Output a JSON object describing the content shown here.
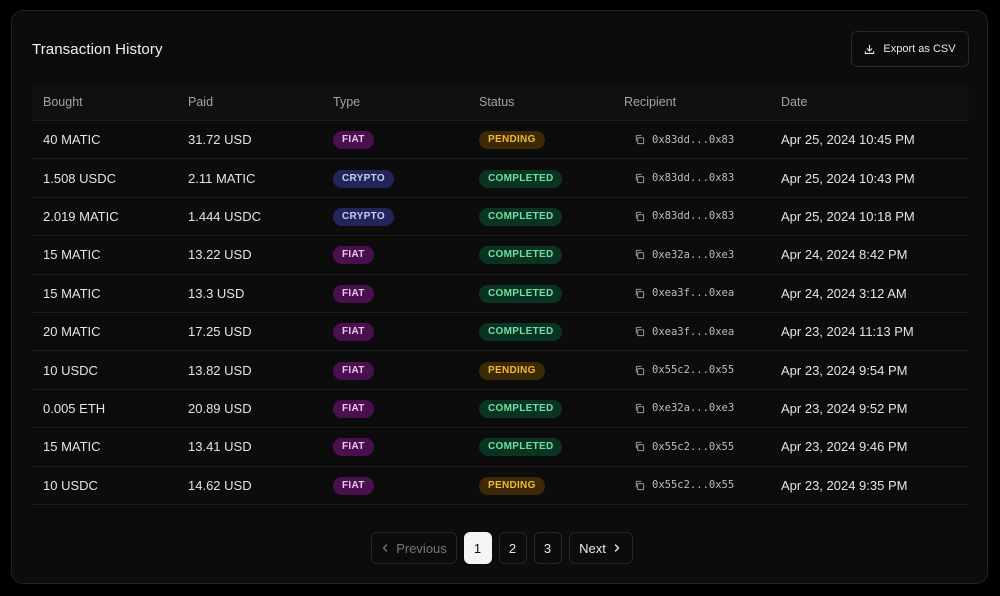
{
  "header": {
    "title": "Transaction History",
    "export_label": "Export as CSV"
  },
  "columns": [
    "Bought",
    "Paid",
    "Type",
    "Status",
    "Recipient",
    "Date"
  ],
  "rows": [
    {
      "bought": "40 MATIC",
      "paid": "31.72 USD",
      "type": "FIAT",
      "status": "PENDING",
      "recipient": "0x83dd...0x83",
      "date": "Apr 25, 2024 10:45 PM"
    },
    {
      "bought": "1.508 USDC",
      "paid": "2.11 MATIC",
      "type": "CRYPTO",
      "status": "COMPLETED",
      "recipient": "0x83dd...0x83",
      "date": "Apr 25, 2024 10:43 PM"
    },
    {
      "bought": "2.019 MATIC",
      "paid": "1.444 USDC",
      "type": "CRYPTO",
      "status": "COMPLETED",
      "recipient": "0x83dd...0x83",
      "date": "Apr 25, 2024 10:18 PM"
    },
    {
      "bought": "15 MATIC",
      "paid": "13.22 USD",
      "type": "FIAT",
      "status": "COMPLETED",
      "recipient": "0xe32a...0xe3",
      "date": "Apr 24, 2024 8:42 PM"
    },
    {
      "bought": "15 MATIC",
      "paid": "13.3 USD",
      "type": "FIAT",
      "status": "COMPLETED",
      "recipient": "0xea3f...0xea",
      "date": "Apr 24, 2024 3:12 AM"
    },
    {
      "bought": "20 MATIC",
      "paid": "17.25 USD",
      "type": "FIAT",
      "status": "COMPLETED",
      "recipient": "0xea3f...0xea",
      "date": "Apr 23, 2024 11:13 PM"
    },
    {
      "bought": "10 USDC",
      "paid": "13.82 USD",
      "type": "FIAT",
      "status": "PENDING",
      "recipient": "0x55c2...0x55",
      "date": "Apr 23, 2024 9:54 PM"
    },
    {
      "bought": "0.005 ETH",
      "paid": "20.89 USD",
      "type": "FIAT",
      "status": "COMPLETED",
      "recipient": "0xe32a...0xe3",
      "date": "Apr 23, 2024 9:52 PM"
    },
    {
      "bought": "15 MATIC",
      "paid": "13.41 USD",
      "type": "FIAT",
      "status": "COMPLETED",
      "recipient": "0x55c2...0x55",
      "date": "Apr 23, 2024 9:46 PM"
    },
    {
      "bought": "10 USDC",
      "paid": "14.62 USD",
      "type": "FIAT",
      "status": "PENDING",
      "recipient": "0x55c2...0x55",
      "date": "Apr 23, 2024 9:35 PM"
    }
  ],
  "pagination": {
    "previous_label": "Previous",
    "next_label": "Next",
    "pages": [
      "1",
      "2",
      "3"
    ],
    "current_page": "1"
  },
  "icons": {
    "export": "download-icon",
    "copy": "copy-icon",
    "prev": "chevron-left-icon",
    "next": "chevron-right-icon"
  },
  "colors": {
    "fiat_badge": "#4a0f4e",
    "crypto_badge": "#23245a",
    "pending_badge": "#3b2a05",
    "completed_badge": "#0b3322"
  }
}
